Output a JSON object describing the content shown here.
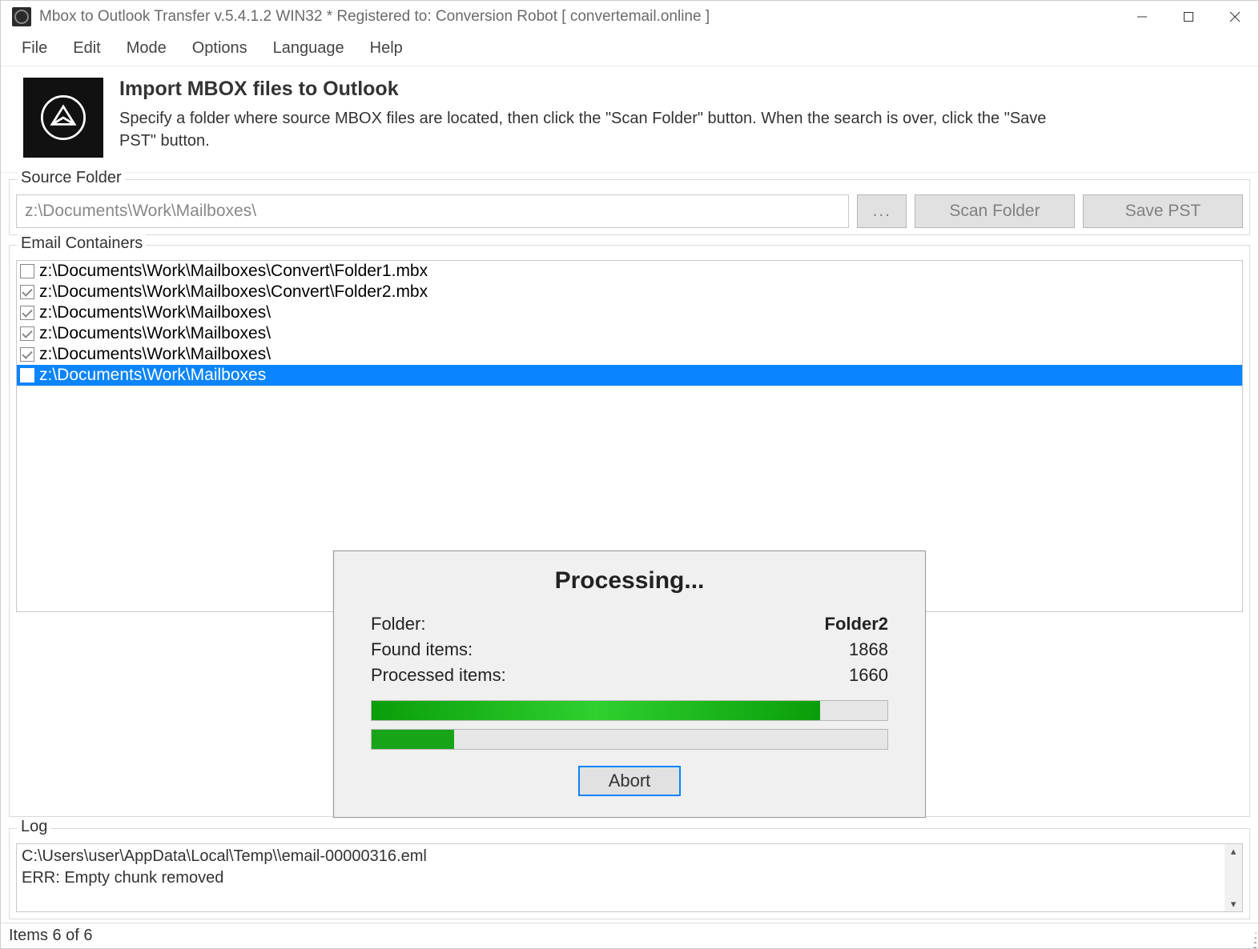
{
  "titlebar": {
    "title": "Mbox to Outlook Transfer v.5.4.1.2 WIN32 * Registered to: Conversion Robot [ convertemail.online ]"
  },
  "menu": {
    "items": [
      "File",
      "Edit",
      "Mode",
      "Options",
      "Language",
      "Help"
    ]
  },
  "header": {
    "title": "Import MBOX files to Outlook",
    "desc": "Specify a folder where source MBOX files are located, then click the \"Scan Folder\" button. When the search is over, click the \"Save PST\" button."
  },
  "source": {
    "label": "Source Folder",
    "path": "z:\\Documents\\Work\\Mailboxes\\",
    "browse": "...",
    "scan": "Scan Folder",
    "save": "Save PST"
  },
  "containers": {
    "label": "Email Containers",
    "rows": [
      {
        "checked": false,
        "selected": false,
        "text": "z:\\Documents\\Work\\Mailboxes\\Convert\\Folder1.mbx"
      },
      {
        "checked": true,
        "selected": false,
        "text": "z:\\Documents\\Work\\Mailboxes\\Convert\\Folder2.mbx"
      },
      {
        "checked": true,
        "selected": false,
        "text": "z:\\Documents\\Work\\Mailboxes\\"
      },
      {
        "checked": true,
        "selected": false,
        "text": "z:\\Documents\\Work\\Mailboxes\\"
      },
      {
        "checked": true,
        "selected": false,
        "text": "z:\\Documents\\Work\\Mailboxes\\"
      },
      {
        "checked": true,
        "selected": true,
        "text": "z:\\Documents\\Work\\Mailboxes"
      }
    ]
  },
  "log": {
    "label": "Log",
    "lines": [
      "C:\\Users\\user\\AppData\\Local\\Temp\\\\email-00000316.eml",
      "ERR: Empty chunk removed"
    ]
  },
  "status": {
    "text": "Items 6 of 6"
  },
  "dialog": {
    "title": "Processing...",
    "folder_label": "Folder:",
    "folder_value": "Folder2",
    "found_label": "Found items:",
    "found_value": "1868",
    "processed_label": "Processed items:",
    "processed_value": "1660",
    "progress1_pct": 87,
    "progress2_pct": 16,
    "abort": "Abort"
  }
}
